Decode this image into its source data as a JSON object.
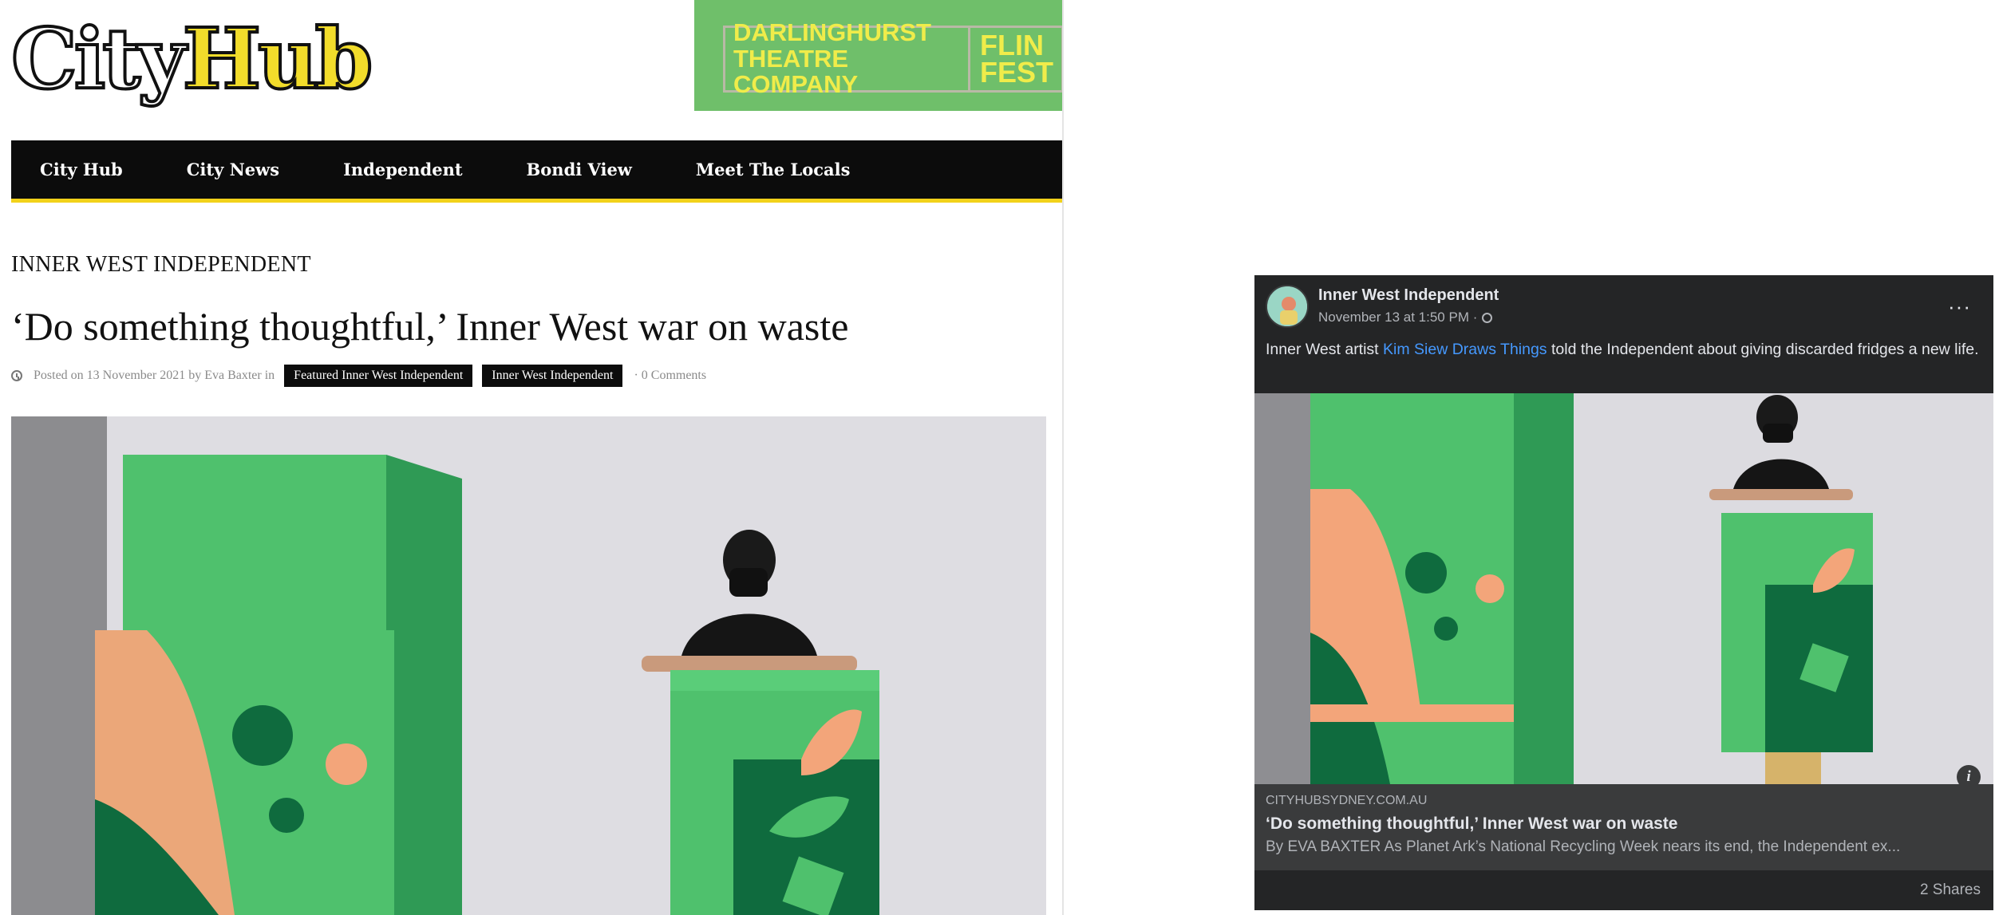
{
  "site": {
    "logo": {
      "city": "City",
      "hub": "Hub"
    },
    "banner": {
      "line1": "DARLINGHURST\nTHEATRE COMPANY",
      "line2": "FLIN\nFEST"
    },
    "nav": [
      "City Hub",
      "City News",
      "Independent",
      "Bondi View",
      "Meet The Locals"
    ],
    "kicker": "INNER WEST INDEPENDENT",
    "headline": "‘Do something thoughtful,’ Inner West war on waste",
    "meta": {
      "posted": "Posted on 13 November 2021 by Eva Baxter in",
      "tags": [
        "Featured Inner West Independent",
        "Inner West Independent"
      ],
      "comments": "· 0 Comments"
    }
  },
  "facebook_post": {
    "page_name": "Inner West Independent",
    "timestamp": "November 13 at 1:50 PM ·",
    "text_before": "Inner West artist ",
    "text_link": "Kim Siew Draws Things",
    "text_after": " told the Independent about giving discarded fridges a new life.",
    "more": "···",
    "info": "i",
    "link_card": {
      "domain": "CITYHUBSYDNEY.COM.AU",
      "title": "‘Do something thoughtful,’ Inner West war on waste",
      "description": "By EVA BAXTER As Planet Ark’s National Recycling Week nears its end, the Independent ex..."
    },
    "shares": "2 Shares"
  },
  "colors": {
    "nav_bg": "#0c0c0c",
    "nav_accent": "#f2d21a",
    "fridge_light": "#4fc16d",
    "fridge_dark": "#0f6b3e",
    "fridge_salmon": "#f3a57a",
    "fb_bg": "#242526",
    "fb_link": "#4599ff"
  }
}
